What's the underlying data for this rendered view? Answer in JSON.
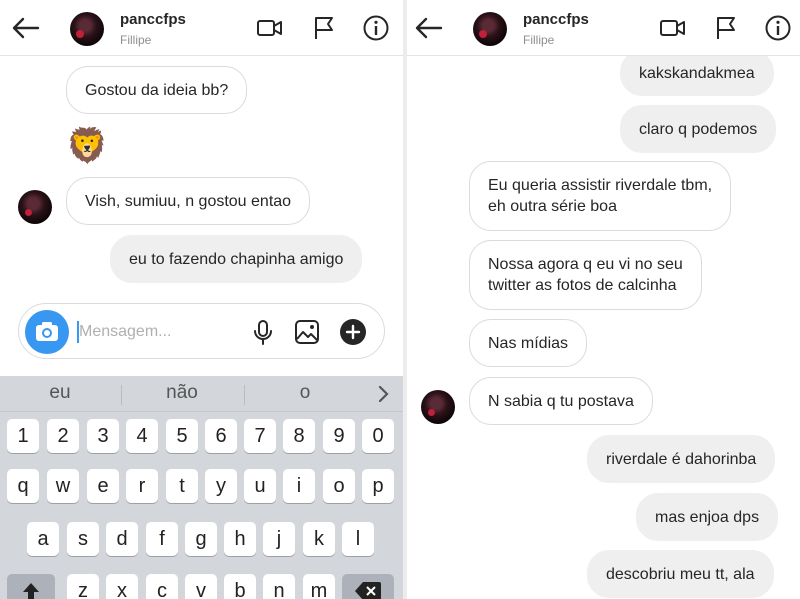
{
  "left": {
    "header": {
      "username": "panccfps",
      "display_name": "Fillipe"
    },
    "messages": [
      {
        "text": "Gostou da ideia bb?",
        "direction": "out-left"
      },
      {
        "emoji": "🦁"
      },
      {
        "text": "Vish, sumiuu, n gostou entao"
      },
      {
        "text": "eu to fazendo chapinha amigo"
      }
    ],
    "composer": {
      "placeholder": "Mensagem..."
    },
    "keyboard": {
      "suggestions": [
        "eu",
        "não",
        "o"
      ],
      "row_numbers": [
        "1",
        "2",
        "3",
        "4",
        "5",
        "6",
        "7",
        "8",
        "9",
        "0"
      ],
      "row_1": [
        "q",
        "w",
        "e",
        "r",
        "t",
        "y",
        "u",
        "i",
        "o",
        "p"
      ],
      "row_2": [
        "a",
        "s",
        "d",
        "f",
        "g",
        "h",
        "j",
        "k",
        "l"
      ],
      "row_3": [
        "z",
        "x",
        "c",
        "v",
        "b",
        "n",
        "m"
      ]
    }
  },
  "right": {
    "header": {
      "username": "panccfps",
      "display_name": "Fillipe"
    },
    "messages": [
      {
        "lines": [
          "kakskandakmea"
        ]
      },
      {
        "lines": [
          "claro q podemos"
        ]
      },
      {
        "lines": [
          "Eu queria assistir riverdale tbm,",
          "eh outra série boa"
        ]
      },
      {
        "lines": [
          "Nossa agora q eu vi no seu",
          "twitter as fotos de calcinha"
        ]
      },
      {
        "lines": [
          "Nas mídias"
        ]
      },
      {
        "lines": [
          "N sabia q tu postava"
        ]
      },
      {
        "lines": [
          "riverdale é dahorinba"
        ]
      },
      {
        "lines": [
          "mas enjoa dps"
        ]
      },
      {
        "lines": [
          "descobriu meu tt, ala"
        ]
      }
    ]
  },
  "colors": {
    "accent": "#3897f0",
    "outgoing_bubble": "#efefef",
    "keyboard_bg": "#d3d6db"
  }
}
